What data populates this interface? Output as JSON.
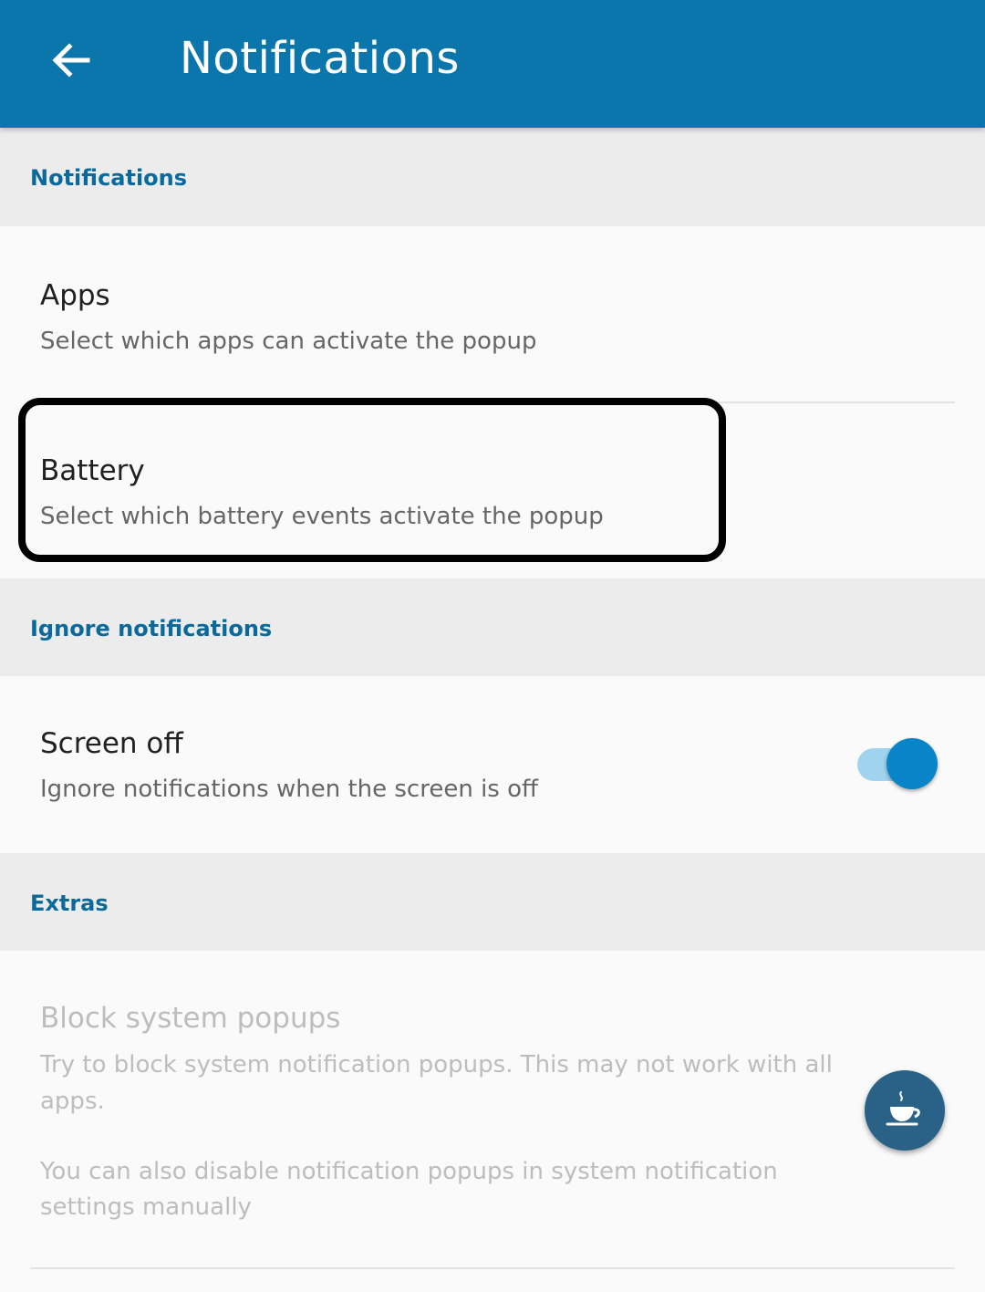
{
  "appbar": {
    "title": "Notifications",
    "back_icon": "arrow-back-icon"
  },
  "sections": [
    {
      "title": "Notifications",
      "items": [
        {
          "title": "Apps",
          "subtitle": "Select which apps can activate the popup"
        },
        {
          "title": "Battery",
          "subtitle": "Select which battery events activate the popup",
          "highlighted": true
        }
      ]
    },
    {
      "title": "Ignore notifications",
      "items": [
        {
          "title": "Screen off",
          "subtitle": "Ignore notifications when the screen is off",
          "toggle_on": true
        }
      ]
    },
    {
      "title": "Extras",
      "items": [
        {
          "title": "Block system popups",
          "subtitle_line1": "Try to block system notification popups. This may not work with all",
          "subtitle_line2": "apps.",
          "note_line1": "You can also disable notification popups in system notification",
          "note_line2": "settings manually",
          "enabled": false
        }
      ]
    }
  ],
  "fab": {
    "icon": "coffee-cup-icon"
  },
  "colors": {
    "primary": "#0a76ac",
    "section_title": "#0a6a9c",
    "toggle_thumb": "#0a84c8",
    "toggle_track": "#9fd3ee",
    "fab": "#2a6186"
  }
}
